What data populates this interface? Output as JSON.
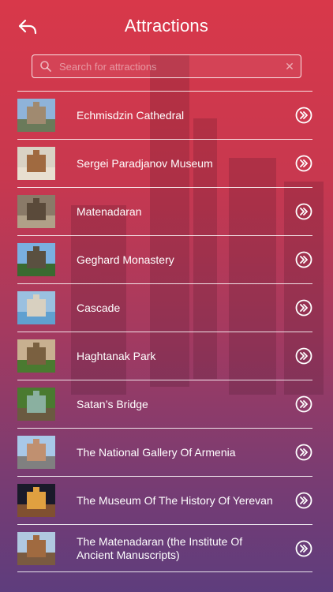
{
  "header": {
    "title": "Attractions",
    "back_icon": "back-arrow-icon"
  },
  "search": {
    "placeholder": "Search for attractions",
    "value": "",
    "icon": "search-icon",
    "clear_icon": "clear-icon"
  },
  "colors": {
    "top_gradient": "#d8384a",
    "bottom_gradient": "#5e3d7d",
    "text": "#ffffff"
  },
  "attractions": [
    {
      "label": "Echmisdzin Cathedral",
      "thumb_colors": [
        "#8fb3d9",
        "#a08a70",
        "#6a7a5a"
      ]
    },
    {
      "label": "Sergei Paradjanov Museum",
      "thumb_colors": [
        "#d9d2c4",
        "#a06a40",
        "#e8dfd0"
      ]
    },
    {
      "label": "Matenadaran",
      "thumb_colors": [
        "#8a7a68",
        "#5a4a3a",
        "#b0a088"
      ]
    },
    {
      "label": "Geghard Monastery",
      "thumb_colors": [
        "#7ab0e0",
        "#5a5040",
        "#3a6a30"
      ]
    },
    {
      "label": "Cascade",
      "thumb_colors": [
        "#9ac0e0",
        "#d8d0c0",
        "#60a0d0"
      ]
    },
    {
      "label": "Haghtanak Park",
      "thumb_colors": [
        "#c8b090",
        "#7a6040",
        "#4a7a30"
      ]
    },
    {
      "label": "Satan’s Bridge",
      "thumb_colors": [
        "#4a7a30",
        "#8ab0a0",
        "#6a5a40"
      ]
    },
    {
      "label": "The National Gallery Of Armenia",
      "thumb_colors": [
        "#a8c8e8",
        "#c09070",
        "#808080"
      ]
    },
    {
      "label": "The Museum Of The History Of Yerevan",
      "thumb_colors": [
        "#1a1a2a",
        "#e0a040",
        "#805030"
      ]
    },
    {
      "label": "The Matenadaran (the Institute Of Ancient Manuscripts)",
      "thumb_colors": [
        "#b0c8e0",
        "#a06a40",
        "#7a5a40"
      ]
    }
  ]
}
